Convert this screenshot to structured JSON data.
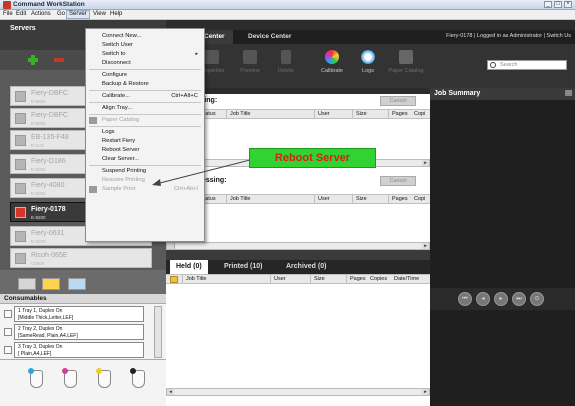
{
  "window": {
    "title": "Command WorkStation",
    "controls": [
      "_",
      "□",
      "×"
    ]
  },
  "menu": [
    "File",
    "Edit",
    "Actions",
    "Go",
    "Server",
    "View",
    "Help"
  ],
  "servers_panel": {
    "title": "Servers",
    "items": [
      {
        "name": "Fiery-DBFC",
        "sub": "E-8000"
      },
      {
        "name": "Fiery-DBFC",
        "sub": "E-8000"
      },
      {
        "name": "EB-135-F48",
        "sub": "E-1LD"
      },
      {
        "name": "Fiery-D186",
        "sub": "E-6000"
      },
      {
        "name": "Fiery-4080",
        "sub": "E-8000"
      },
      {
        "name": "Fiery-0178",
        "sub": "E-8200"
      },
      {
        "name": "Fiery-0631",
        "sub": "E-8200"
      },
      {
        "name": "Ricoh-065E",
        "sub": "C8000"
      }
    ]
  },
  "header_tabs": {
    "center": "Center",
    "device": "Device Center",
    "info": "Fiery-0178 | Logged in as Administrator | Switch Us"
  },
  "toolbar": {
    "buttons": [
      "Properties",
      "Preview",
      "Delete",
      "Calibrate",
      "Logs",
      "Paper Catalog"
    ],
    "search_placeholder": "Search"
  },
  "printing_queue": {
    "title": "ting:",
    "cancel": "Cancel",
    "columns": [
      "Status",
      "Job Title",
      "User",
      "Size",
      "Pages",
      "Copi"
    ]
  },
  "processing_queue": {
    "title": "essing:",
    "cancel": "Cancel",
    "columns": [
      "Status",
      "Job Title",
      "User",
      "Size",
      "Pages",
      "Copi"
    ]
  },
  "job_summary": {
    "title": "Job Summary"
  },
  "held_tabs": [
    "Held (0)",
    "Printed (10)",
    "Archived (0)"
  ],
  "held_columns": [
    "Job Title",
    "User",
    "Size",
    "Pages",
    "Copies",
    "Date/Time"
  ],
  "consumables": {
    "title": "Consumables",
    "trays": [
      {
        "l1": "1  Tray 1, Duplex On",
        "l2": "[Middle Thick,Letter,LEF]"
      },
      {
        "l1": "2  Tray 2, Duplex On",
        "l2": "[SameRead, Plain,A4,LEF]"
      },
      {
        "l1": "3  Tray 3, Duplex On",
        "l2": "[ Plain,A4,LEF]"
      }
    ],
    "toner_colors": [
      "#2aa7e0",
      "#d63aa0",
      "#e8d31c",
      "#222222"
    ]
  },
  "server_menu": {
    "items": [
      {
        "label": "Connect New...",
        "dim": false
      },
      {
        "label": "Switch User",
        "dim": false
      },
      {
        "label": "Switch to",
        "dim": false,
        "arrow": "▸"
      },
      {
        "label": "Disconnect",
        "dim": false
      },
      {
        "sep": true
      },
      {
        "label": "Configure",
        "dim": false
      },
      {
        "label": "Backup & Restore",
        "dim": false
      },
      {
        "sep": true
      },
      {
        "label": "Calibrate...",
        "dim": false,
        "shortcut": "Ctrl+Alt+C"
      },
      {
        "sep": true
      },
      {
        "label": "Align Tray...",
        "dim": false
      },
      {
        "sep": true
      },
      {
        "label": "Paper Catalog",
        "dim": true,
        "icon": true
      },
      {
        "sep": true
      },
      {
        "label": "Logs",
        "dim": false
      },
      {
        "label": "Restart Fiery",
        "dim": false
      },
      {
        "label": "Reboot Server",
        "dim": false
      },
      {
        "label": "Clear Server...",
        "dim": false
      },
      {
        "sep": true
      },
      {
        "label": "Suspend Printing",
        "dim": false
      },
      {
        "label": "Resume Printing",
        "dim": true
      },
      {
        "label": "Sample Print",
        "dim": true,
        "shortcut": "Ctrl+Alt+I",
        "icon": true
      }
    ]
  },
  "callout": "Reboot Server"
}
